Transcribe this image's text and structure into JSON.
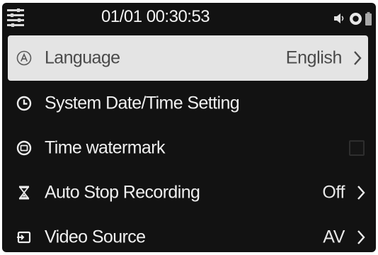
{
  "status_bar": {
    "datetime": "01/01 00:30:53"
  },
  "colors": {
    "background": "#121212",
    "text": "#f0f0f0",
    "selected_row": "#e4e4e4",
    "selected_text": "#4a4a4a"
  },
  "menu": {
    "items": [
      {
        "label": "Language",
        "value": "English",
        "icon": "language-a-icon",
        "control": "chevron",
        "selected": true
      },
      {
        "label": "System Date/Time Setting",
        "value": "",
        "icon": "clock-icon",
        "control": "none",
        "selected": false
      },
      {
        "label": "Time watermark",
        "value": "",
        "icon": "watermark-icon",
        "control": "checkbox",
        "checked": false,
        "selected": false
      },
      {
        "label": "Auto Stop Recording",
        "value": "Off",
        "icon": "hourglass-icon",
        "control": "chevron",
        "selected": false
      },
      {
        "label": "Video Source",
        "value": "AV",
        "icon": "video-input-icon",
        "control": "chevron",
        "selected": false
      }
    ]
  }
}
